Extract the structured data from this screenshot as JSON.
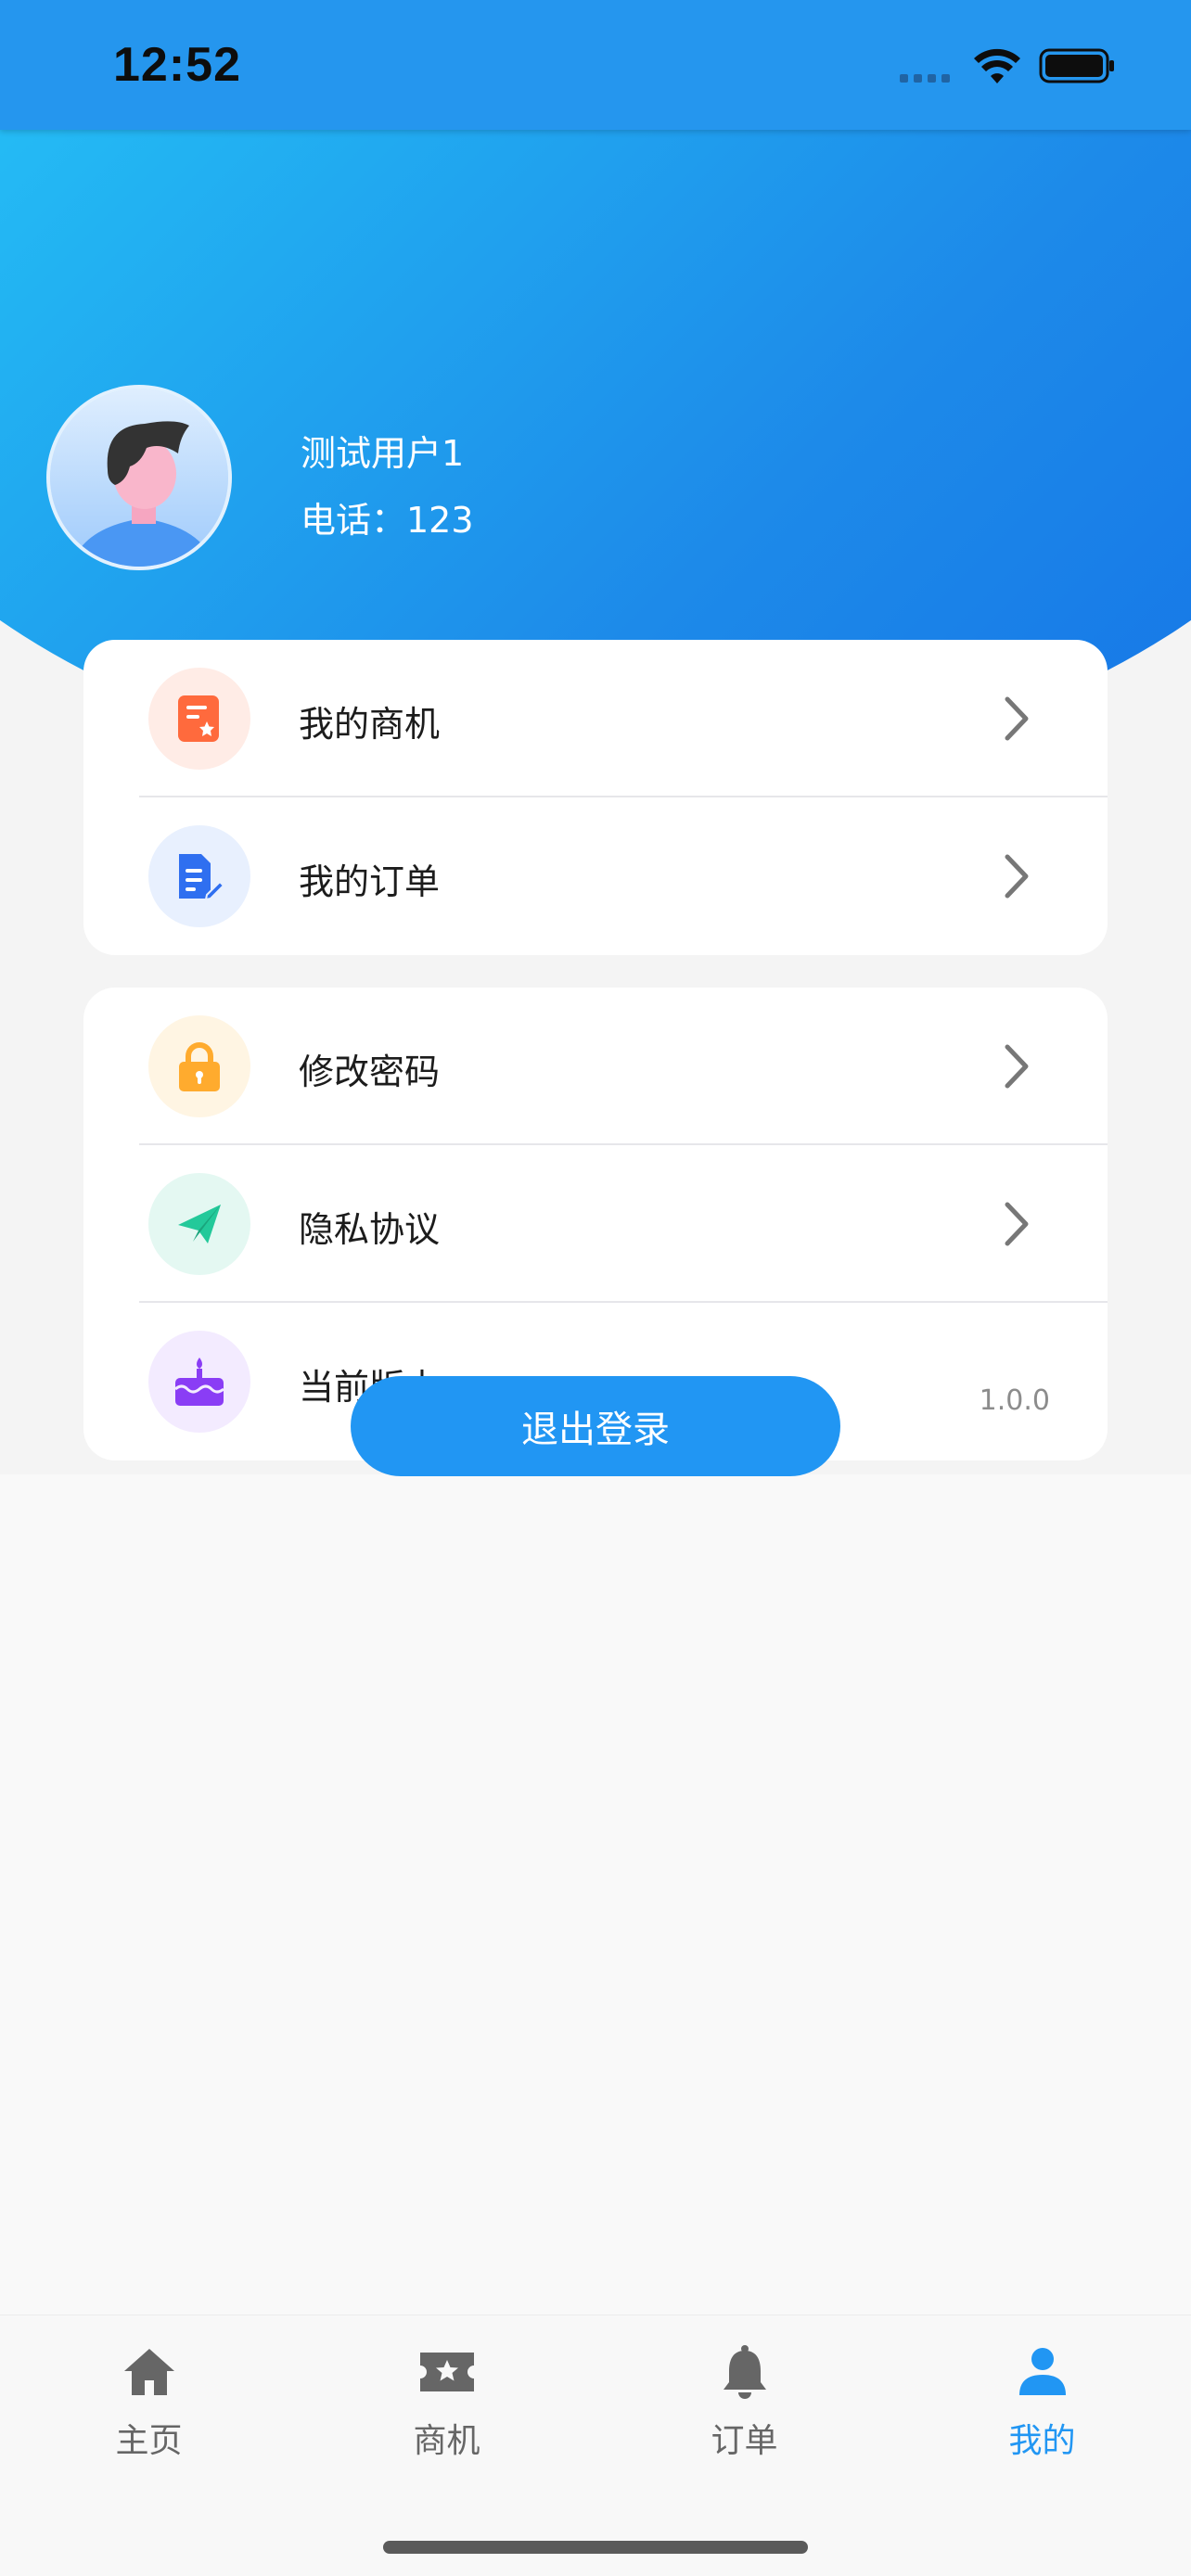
{
  "status_bar": {
    "time": "12:52"
  },
  "profile": {
    "name": "测试用户1",
    "phone": "电话：123"
  },
  "menu_group_1": [
    {
      "label": "我的商机",
      "icon": "opportunity-icon",
      "icon_color": "#ff6a3d",
      "icon_bg": "#ffece6"
    },
    {
      "label": "我的订单",
      "icon": "order-doc-icon",
      "icon_color": "#2f6ff0",
      "icon_bg": "#e8f0fe"
    }
  ],
  "menu_group_2": [
    {
      "label": "修改密码",
      "icon": "lock-icon",
      "icon_color": "#ffab2e",
      "icon_bg": "#fff5e3"
    },
    {
      "label": "隐私协议",
      "icon": "paper-plane-icon",
      "icon_color": "#23c99a",
      "icon_bg": "#e4f8f2"
    },
    {
      "label": "当前版本",
      "icon": "cake-icon",
      "icon_color": "#8a3df5",
      "icon_bg": "#f3ebff",
      "value": "1.0.0"
    }
  ],
  "logout_label": "退出登录",
  "tabs": [
    {
      "label": "主页",
      "icon": "home-icon",
      "active": false
    },
    {
      "label": "商机",
      "icon": "ticket-star-icon",
      "active": false
    },
    {
      "label": "订单",
      "icon": "bell-icon",
      "active": false
    },
    {
      "label": "我的",
      "icon": "person-icon",
      "active": true
    }
  ],
  "colors": {
    "accent": "#2196f3",
    "header_gradient_start": "#2bd2fb",
    "header_gradient_end": "#1471e6",
    "tab_inactive": "#666666"
  }
}
